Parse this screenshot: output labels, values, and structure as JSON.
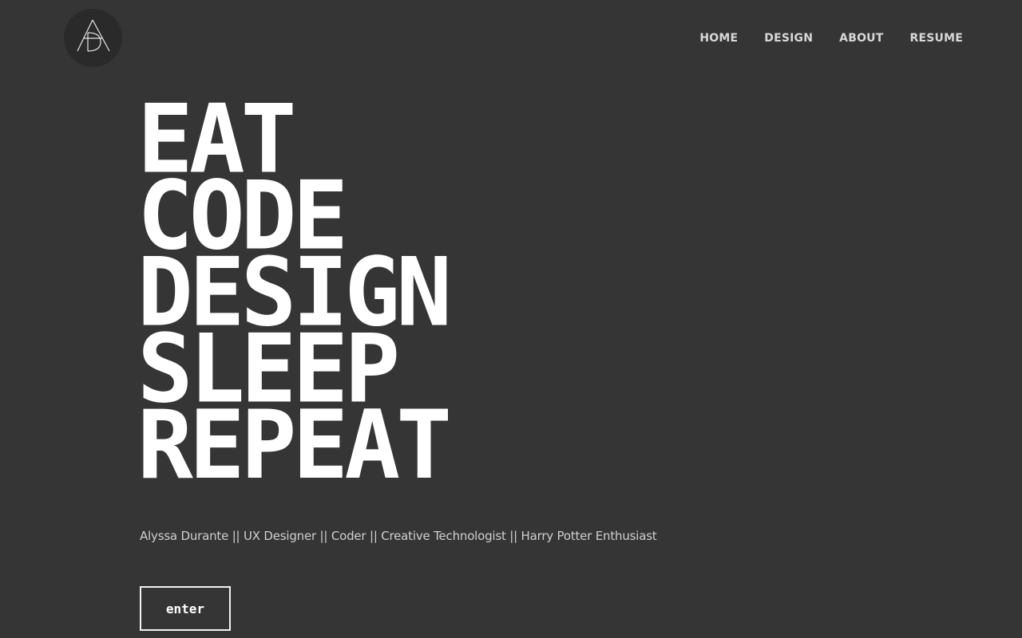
{
  "header": {
    "logo_text": "ADA",
    "nav": [
      {
        "label": "HOME"
      },
      {
        "label": "DESIGN"
      },
      {
        "label": "ABOUT"
      },
      {
        "label": "RESUME"
      }
    ]
  },
  "hero": {
    "lines": [
      "EAT",
      "CODE",
      "DESIGN",
      "SLEEP",
      "REPEAT"
    ],
    "tagline": "Alyssa Durante || UX Designer || Coder || Creative Technologist || Harry Potter Enthusiast",
    "enter_label": "enter"
  },
  "colors": {
    "background": "#353535",
    "logo_circle": "#2a2a2a",
    "headline": "#ffffff",
    "nav_text": "#d8d8d8",
    "tagline": "#cfcfcf"
  }
}
